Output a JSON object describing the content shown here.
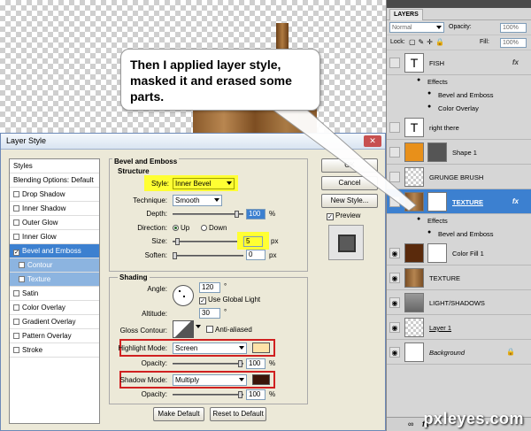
{
  "callout": {
    "text": "Then I applied layer style, masked it and erased some parts."
  },
  "dialog": {
    "title": "Layer Style",
    "close": "✕",
    "styles_list": [
      {
        "label": "Styles",
        "checkbox": false,
        "state": "header"
      },
      {
        "label": "Blending Options: Default",
        "checkbox": false,
        "state": "normal"
      },
      {
        "label": "Drop Shadow",
        "checkbox": true,
        "checked": false,
        "state": "normal"
      },
      {
        "label": "Inner Shadow",
        "checkbox": true,
        "checked": false,
        "state": "normal"
      },
      {
        "label": "Outer Glow",
        "checkbox": true,
        "checked": false,
        "state": "normal"
      },
      {
        "label": "Inner Glow",
        "checkbox": true,
        "checked": false,
        "state": "normal"
      },
      {
        "label": "Bevel and Emboss",
        "checkbox": true,
        "checked": true,
        "state": "selected"
      },
      {
        "label": "Contour",
        "checkbox": true,
        "checked": false,
        "state": "sub"
      },
      {
        "label": "Texture",
        "checkbox": true,
        "checked": false,
        "state": "sub"
      },
      {
        "label": "Satin",
        "checkbox": true,
        "checked": false,
        "state": "normal"
      },
      {
        "label": "Color Overlay",
        "checkbox": true,
        "checked": false,
        "state": "normal"
      },
      {
        "label": "Gradient Overlay",
        "checkbox": true,
        "checked": false,
        "state": "normal"
      },
      {
        "label": "Pattern Overlay",
        "checkbox": true,
        "checked": false,
        "state": "normal"
      },
      {
        "label": "Stroke",
        "checkbox": true,
        "checked": false,
        "state": "normal"
      }
    ],
    "bevel": {
      "title": "Bevel and Emboss",
      "structure_title": "Structure",
      "style_label": "Style:",
      "style_value": "Inner Bevel",
      "technique_label": "Technique:",
      "technique_value": "Smooth",
      "depth_label": "Depth:",
      "depth_value": "100",
      "depth_unit": "%",
      "direction_label": "Direction:",
      "direction_up": "Up",
      "direction_down": "Down",
      "direction_selected": "Up",
      "size_label": "Size:",
      "size_value": "5",
      "size_unit": "px",
      "soften_label": "Soften:",
      "soften_value": "0",
      "soften_unit": "px"
    },
    "shading": {
      "title": "Shading",
      "angle_label": "Angle:",
      "angle_value": "120",
      "angle_unit": "°",
      "global_light_label": "Use Global Light",
      "global_light_checked": true,
      "altitude_label": "Altitude:",
      "altitude_value": "30",
      "altitude_unit": "°",
      "gloss_label": "Gloss Contour:",
      "anti_aliased_label": "Anti-aliased",
      "anti_aliased_checked": false,
      "highlight_mode_label": "Highlight Mode:",
      "highlight_mode_value": "Screen",
      "highlight_color": "#fde3a8",
      "highlight_opacity_label": "Opacity:",
      "highlight_opacity_value": "100",
      "shadow_mode_label": "Shadow Mode:",
      "shadow_mode_value": "Multiply",
      "shadow_color": "#3a1408",
      "shadow_opacity_label": "Opacity:",
      "shadow_opacity_value": "100",
      "pct": "%"
    },
    "buttons": {
      "ok": "OK",
      "cancel": "Cancel",
      "new_style": "New Style...",
      "preview": "Preview",
      "preview_checked": true,
      "make_default": "Make Default",
      "reset_default": "Reset to Default"
    }
  },
  "layers_panel": {
    "tab": "LAYERS",
    "blend_mode": "Normal",
    "opacity_label": "Opacity:",
    "opacity_value": "100%",
    "lock_label": "Lock:",
    "fill_label": "Fill:",
    "fill_value": "100%",
    "layers": [
      {
        "name": "FISH",
        "thumb": "text",
        "fx": true,
        "visible": false
      },
      {
        "name": "Effects",
        "kind": "effects-header"
      },
      {
        "name": "Bevel and Emboss",
        "kind": "effect"
      },
      {
        "name": "Color Overlay",
        "kind": "effect"
      },
      {
        "name": "right there",
        "thumb": "text",
        "visible": false
      },
      {
        "name": "Shape 1",
        "thumb": "orange",
        "mask": true,
        "visible": false
      },
      {
        "name": "GRUNGE BRUSH",
        "thumb": "checker",
        "visible": false
      },
      {
        "name": "TEXTURE",
        "thumb": "wood",
        "mask": true,
        "fx": true,
        "selected": true,
        "visible": false
      },
      {
        "name": "Effects",
        "kind": "effects-header"
      },
      {
        "name": "Bevel and Emboss",
        "kind": "effect"
      },
      {
        "name": "Color Fill 1",
        "thumb": "brown",
        "mask": true,
        "visible": true
      },
      {
        "name": "TEXTURE",
        "thumb": "wood",
        "visible": true
      },
      {
        "name": "LIGHT/SHADOWS",
        "thumb": "gray",
        "visible": true
      },
      {
        "name": "Layer 1",
        "thumb": "checker",
        "visible": true
      },
      {
        "name": "Background",
        "thumb": "white",
        "visible": true,
        "locked": true
      }
    ],
    "fx_label": "fx"
  },
  "watermark": "pxleyes.com",
  "colors": {
    "selection": "#3c80d0",
    "highlight": "#ffff33",
    "annotation_red": "#d02020"
  }
}
